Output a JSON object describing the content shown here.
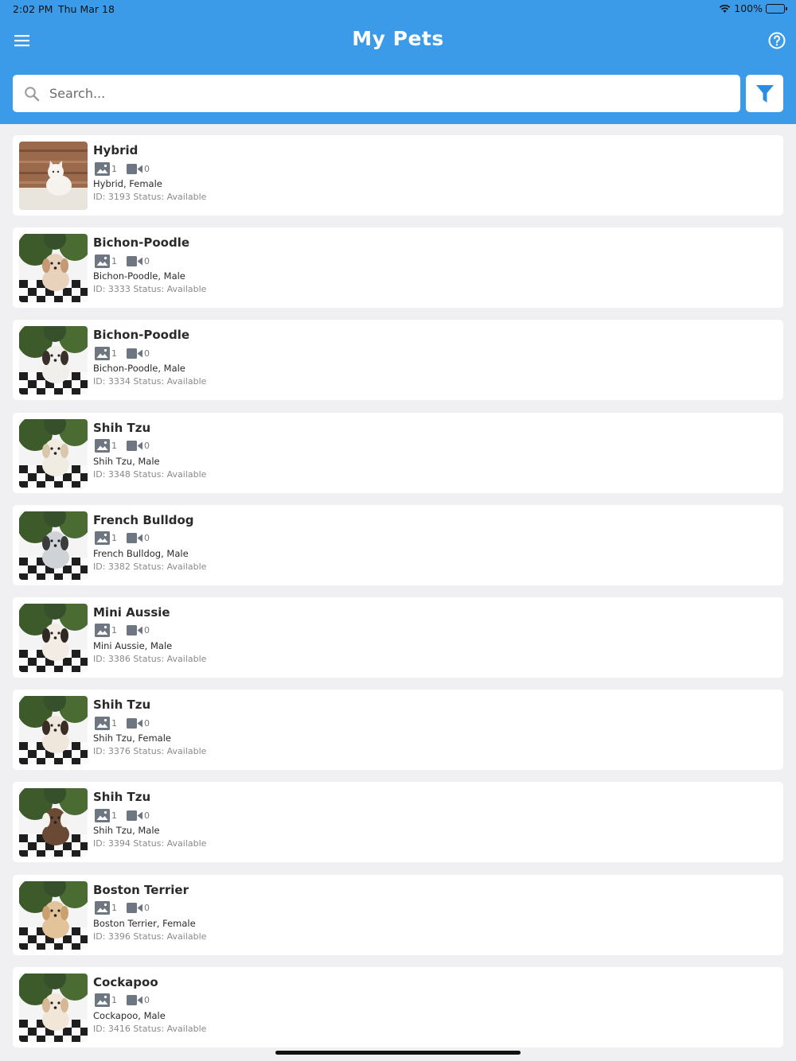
{
  "status_bar": {
    "time": "2:02 PM",
    "date": "Thu Mar 18",
    "battery": "100%"
  },
  "header": {
    "title": "My Pets",
    "menu_icon": "hamburger-menu-icon",
    "help_icon": "question-circle-icon",
    "background_color": "#3b9be8"
  },
  "search": {
    "placeholder": "Search...",
    "value": "",
    "filter_icon": "funnel-filter-icon"
  },
  "pets": [
    {
      "name": "Hybrid",
      "photos": "1",
      "videos": "0",
      "description": "Hybrid, Female",
      "meta": "ID: 3193 Status: Available",
      "photo": "kitten-on-wood"
    },
    {
      "name": "Bichon-Poodle",
      "photos": "1",
      "videos": "0",
      "description": "Bichon-Poodle, Male",
      "meta": "ID: 3333 Status: Available",
      "photo": "puppy-on-plaid"
    },
    {
      "name": "Bichon-Poodle",
      "photos": "1",
      "videos": "0",
      "description": "Bichon-Poodle, Male",
      "meta": "ID: 3334 Status: Available",
      "photo": "puppy-on-plaid"
    },
    {
      "name": "Shih Tzu",
      "photos": "1",
      "videos": "0",
      "description": "Shih Tzu, Male",
      "meta": "ID: 3348 Status: Available",
      "photo": "puppy-on-plaid"
    },
    {
      "name": "French Bulldog",
      "photos": "1",
      "videos": "0",
      "description": "French Bulldog, Male",
      "meta": "ID: 3382 Status: Available",
      "photo": "puppy-on-plaid"
    },
    {
      "name": "Mini Aussie",
      "photos": "1",
      "videos": "0",
      "description": "Mini Aussie, Male",
      "meta": "ID: 3386 Status: Available",
      "photo": "puppy-on-plaid"
    },
    {
      "name": "Shih Tzu",
      "photos": "1",
      "videos": "0",
      "description": "Shih Tzu, Female",
      "meta": "ID: 3376 Status: Available",
      "photo": "puppy-on-plaid"
    },
    {
      "name": "Shih Tzu",
      "photos": "1",
      "videos": "0",
      "description": "Shih Tzu, Male",
      "meta": "ID: 3394 Status: Available",
      "photo": "puppy-on-plaid"
    },
    {
      "name": "Boston Terrier",
      "photos": "1",
      "videos": "0",
      "description": "Boston Terrier, Female",
      "meta": "ID: 3396 Status: Available",
      "photo": "puppy-on-plaid"
    },
    {
      "name": "Cockapoo",
      "photos": "1",
      "videos": "0",
      "description": "Cockapoo, Male",
      "meta": "ID: 3416 Status: Available",
      "photo": "puppy-on-plaid"
    }
  ]
}
